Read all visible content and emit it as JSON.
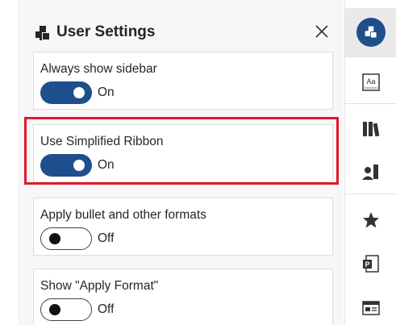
{
  "panel": {
    "title": "User Settings",
    "logo_icon": "cube-logo-icon",
    "close_icon": "close-icon"
  },
  "settings": [
    {
      "label": "Always show sidebar",
      "state": "On",
      "enabled": true
    },
    {
      "label": "Use Simplified Ribbon",
      "state": "On",
      "enabled": true,
      "highlighted": true
    },
    {
      "label": "Apply bullet and other formats",
      "state": "Off",
      "enabled": false
    },
    {
      "label": "Show \"Apply Format\"",
      "state": "Off",
      "enabled": false
    }
  ],
  "toolbar": {
    "items": [
      {
        "icon": "user-settings-icon",
        "active": true
      },
      {
        "icon": "text-style-icon"
      },
      {
        "icon": "library-icon"
      },
      {
        "icon": "people-icon"
      },
      {
        "icon": "star-icon"
      },
      {
        "icon": "powerpoint-icon"
      },
      {
        "icon": "format-panel-icon"
      }
    ]
  },
  "colors": {
    "accent": "#1f4e8c",
    "highlight": "#e0182c"
  }
}
